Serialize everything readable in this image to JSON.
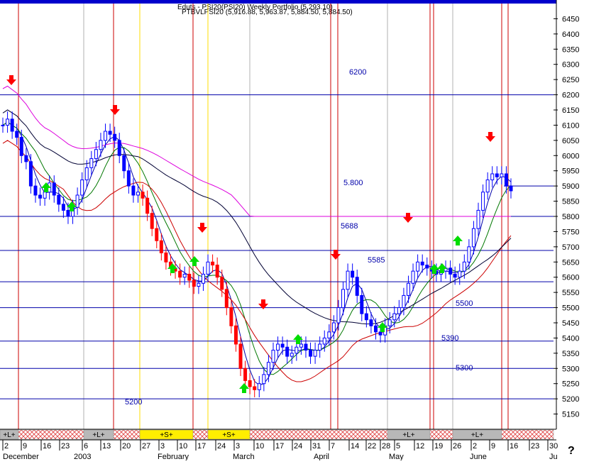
{
  "header": {
    "line1": "Eduts - PSI20(PSI20) Weekly Portfolio (5,293.10)",
    "line2": "PTBVLPSI20 (5,916.88, 5,963.87, 5,884.50, 5,884.50)"
  },
  "help_label": "?",
  "colors": {
    "price_up": "#ffffff",
    "price_down": "#0000ff",
    "bear_bar": "#ff0000",
    "ma_short": "#0000aa",
    "ma_mid": "#007700",
    "ma_long": "#cc0000",
    "ma_black": "#000033",
    "ma_magenta": "#dd00dd",
    "level_line": "#0000aa",
    "vline": "#cc0000",
    "vline_light": "#b0b0b0",
    "vline_yellow": "#ffdd00",
    "signal_up": "#00dd00",
    "signal_down": "#ff0000"
  },
  "chart_data": {
    "type": "candlestick",
    "y_axis": {
      "min": 5100,
      "max": 6500,
      "ticks": [
        5150,
        5200,
        5250,
        5300,
        5350,
        5400,
        5450,
        5500,
        5550,
        5600,
        5650,
        5700,
        5750,
        5800,
        5850,
        5900,
        5950,
        6000,
        6050,
        6100,
        6150,
        6200,
        6250,
        6300,
        6350,
        6400,
        6450
      ]
    },
    "x_axis": {
      "day_ticks": [
        "2",
        "9",
        "16",
        "23",
        "6",
        "13",
        "20",
        "27",
        "3",
        "10",
        "17",
        "24",
        "3",
        "10",
        "17",
        "24",
        "31",
        "7",
        "14",
        "22",
        "28",
        "5",
        "12",
        "19",
        "26",
        "2",
        "9",
        "16",
        "23",
        "30"
      ],
      "month_labels": [
        "December",
        "2003",
        "February",
        "March",
        "April",
        "May",
        "June",
        "Ju"
      ]
    },
    "horizontal_levels": [
      {
        "value": 6200,
        "label": "6200"
      },
      {
        "value": 5800,
        "label": "5.800"
      },
      {
        "value": 5688,
        "label": "5688"
      },
      {
        "value": 5585,
        "label": "5585"
      },
      {
        "value": 5500,
        "label": "5500"
      },
      {
        "value": 5390,
        "label": "5390"
      },
      {
        "value": 5300,
        "label": "5300"
      },
      {
        "value": 5200,
        "label": "5200"
      },
      {
        "value": 5900,
        "label": ""
      }
    ],
    "series": [
      {
        "name": "PTBVLPSI20",
        "style": "candles",
        "values": [
          6100,
          6120,
          6080,
          6060,
          6000,
          5980,
          5900,
          5870,
          5860,
          5880,
          5910,
          5870,
          5840,
          5820,
          5800,
          5830,
          5870,
          5920,
          5960,
          5990,
          6020,
          6050,
          6080,
          6070,
          6050,
          6000,
          5950,
          5900,
          5870,
          5880,
          5860,
          5810,
          5760,
          5720,
          5680,
          5650,
          5630,
          5620,
          5600,
          5610,
          5590,
          5570,
          5580,
          5610,
          5650,
          5640,
          5600,
          5560,
          5500,
          5440,
          5380,
          5300,
          5260,
          5240,
          5230,
          5250,
          5280,
          5320,
          5360,
          5380,
          5370,
          5340,
          5350,
          5370,
          5380,
          5360,
          5340,
          5360,
          5380,
          5400,
          5420,
          5450,
          5500,
          5560,
          5620,
          5600,
          5540,
          5480,
          5460,
          5440,
          5420,
          5410,
          5440,
          5460,
          5480,
          5500,
          5540,
          5580,
          5620,
          5650,
          5640,
          5630,
          5620,
          5610,
          5620,
          5630,
          5610,
          5600,
          5620,
          5650,
          5700,
          5760,
          5820,
          5880,
          5920,
          5940,
          5930,
          5940,
          5900,
          5884
        ]
      }
    ]
  },
  "band_labels": [
    "+L+",
    "+L+",
    "+S+",
    "+S+",
    "+L+",
    "+L+"
  ]
}
